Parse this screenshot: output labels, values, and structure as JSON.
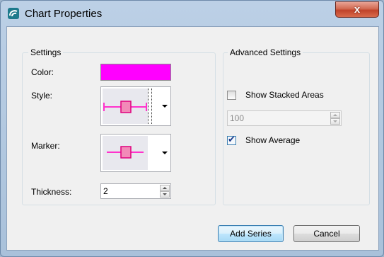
{
  "window": {
    "title": "Chart Properties",
    "close_label": "x",
    "app_icon": "chart-app-icon"
  },
  "settings": {
    "caption": "Settings",
    "color_label": "Color:",
    "color_value": "#ff00ff",
    "style_label": "Style:",
    "style_icon": "line-with-square-marker-icon",
    "marker_label": "Marker:",
    "marker_icon": "square-marker-icon",
    "thickness_label": "Thickness:",
    "thickness_value": "2"
  },
  "advanced": {
    "caption": "Advanced Settings",
    "show_stacked_label": "Show Stacked Areas",
    "show_stacked_checked": false,
    "stack_value": "100",
    "show_average_label": "Show Average",
    "show_average_checked": true
  },
  "buttons": {
    "add_series": "Add Series",
    "cancel": "Cancel"
  }
}
